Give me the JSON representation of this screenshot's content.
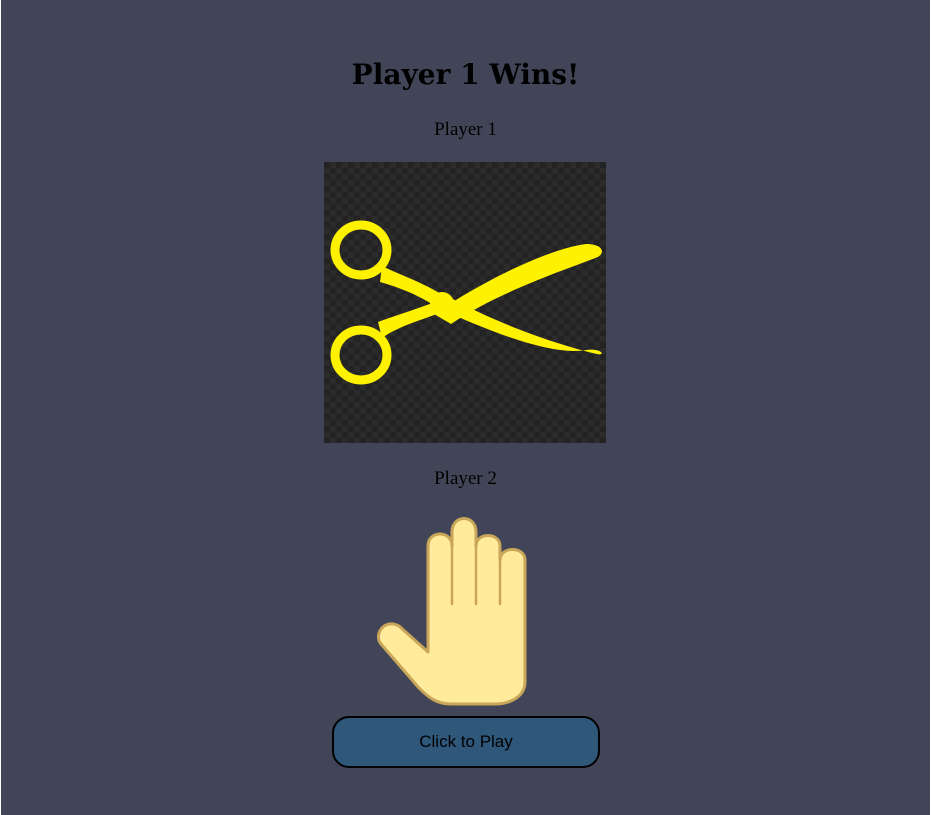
{
  "game": {
    "result_title": "Player 1 Wins!",
    "player1": {
      "label": "Player 1",
      "choice": "scissors",
      "icon": "scissors-icon",
      "icon_color": "#fff200"
    },
    "player2": {
      "label": "Player 2",
      "choice": "paper",
      "icon": "open-hand-icon",
      "icon_color": "#ffeb9b"
    },
    "play_button_label": "Click to Play"
  },
  "colors": {
    "background": "#414557",
    "button_fill": "#2e5779",
    "choice_box_bg": "#232323"
  }
}
